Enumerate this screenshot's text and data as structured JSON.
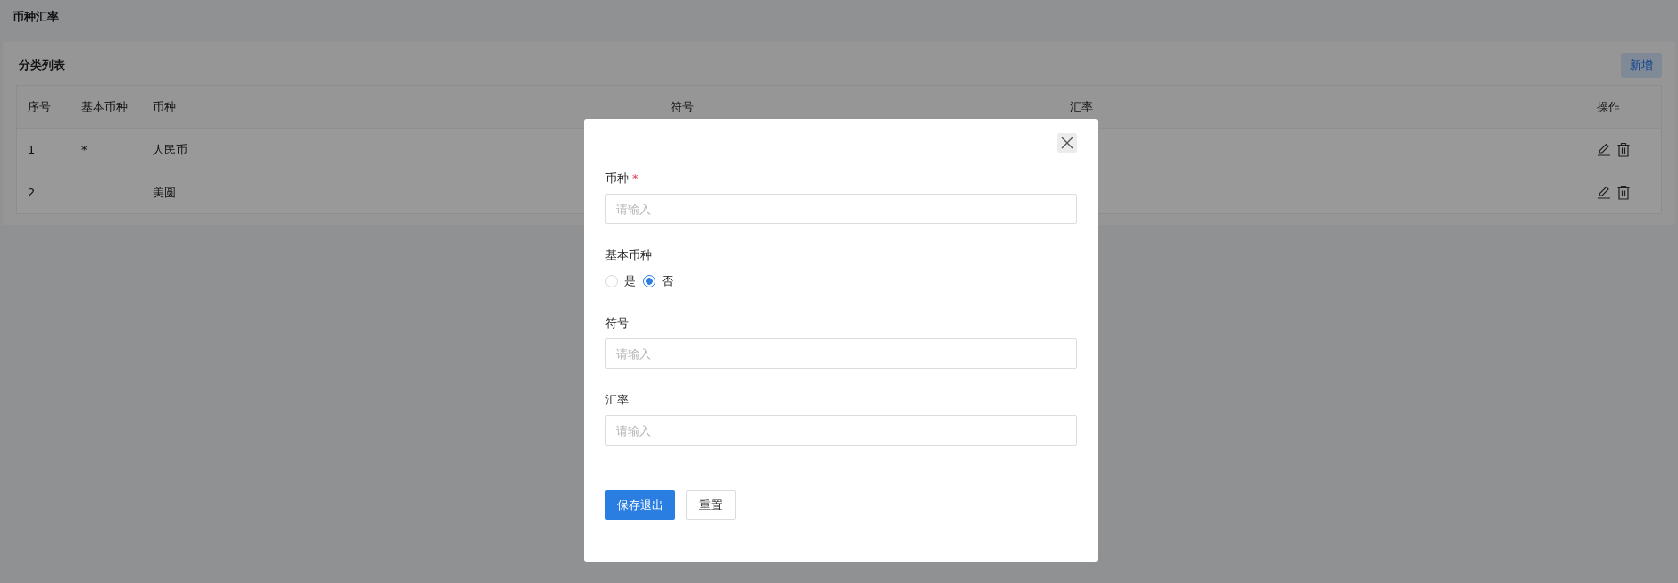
{
  "page": {
    "title": "币种汇率"
  },
  "panel": {
    "title": "分类列表",
    "add_button": "新增"
  },
  "table": {
    "columns": [
      "序号",
      "基本币种",
      "币种",
      "符号",
      "汇率",
      "操作"
    ],
    "rows": [
      {
        "index": "1",
        "base": "*",
        "currency": "人民币"
      },
      {
        "index": "2",
        "currency": "美圆"
      }
    ]
  },
  "dialog": {
    "fields": [
      {
        "kind": "text",
        "label": "币种",
        "required": true,
        "placeholder": "请输入"
      },
      {
        "kind": "radio",
        "label": "基本币种",
        "required": false,
        "options": [
          {
            "label": "是",
            "selected": false
          },
          {
            "label": "否",
            "selected": true
          }
        ]
      },
      {
        "kind": "text",
        "label": "符号",
        "required": false,
        "placeholder": "请输入"
      },
      {
        "kind": "text",
        "label": "汇率",
        "required": false,
        "placeholder": "请输入"
      }
    ],
    "buttons": [
      {
        "kind": "primary",
        "label": "保存退出"
      },
      {
        "kind": "default",
        "label": "重置"
      }
    ]
  }
}
